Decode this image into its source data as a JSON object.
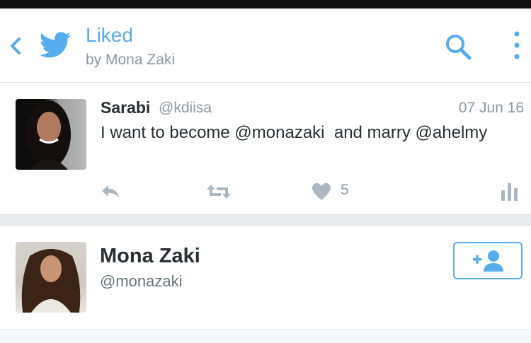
{
  "colors": {
    "accent": "#55acee",
    "icon_gray": "#aab8c2",
    "text_dark": "#292f33",
    "text_secondary": "#8899a6"
  },
  "header": {
    "back_icon": "chevron-left-icon",
    "logo_icon": "twitter-bird-icon",
    "title": "Liked",
    "subtitle": "by Mona Zaki",
    "search_icon": "search-icon",
    "more_icon": "more-vertical-icon"
  },
  "tweet": {
    "author_name": "Sarabi",
    "author_handle": "@kdiisa",
    "date": "07 Jun 16",
    "text": "I want to become @monazaki  and marry @ahelmy",
    "actions": {
      "reply_icon": "reply-icon",
      "retweet_icon": "retweet-icon",
      "like_icon": "heart-icon",
      "like_count": "5",
      "stats_icon": "bar-chart-icon"
    }
  },
  "user_card": {
    "name": "Mona Zaki",
    "handle": "@monazaki",
    "follow_icon": "add-user-icon"
  }
}
